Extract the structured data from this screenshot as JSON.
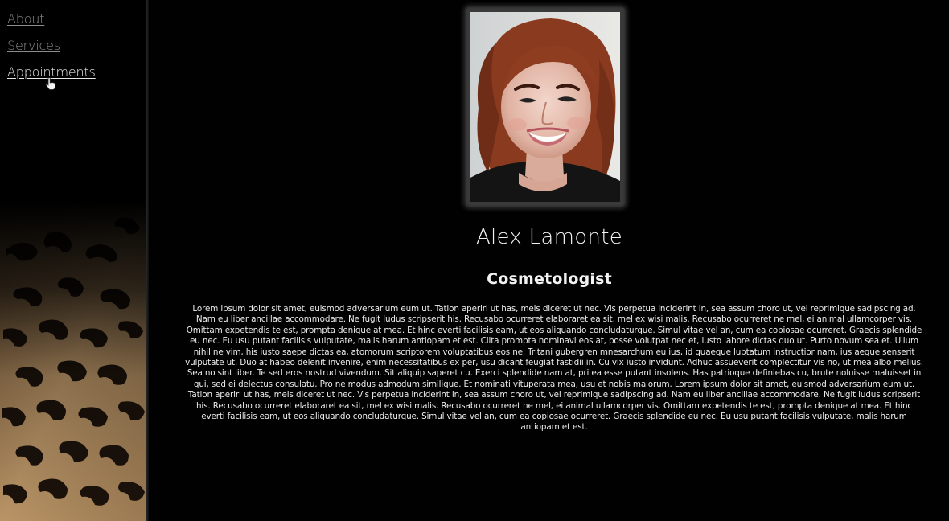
{
  "nav": {
    "items": [
      {
        "label": "About"
      },
      {
        "label": "Services"
      },
      {
        "label": "Appointments"
      }
    ]
  },
  "profile": {
    "name": "Alex Lamonte",
    "title": "Cosmetologist",
    "bio": "Lorem ipsum dolor sit amet, euismod adversarium eum ut. Tation aperiri ut has, meis diceret ut nec. Vis perpetua inciderint in, sea assum choro ut, vel reprimique sadipscing ad. Nam eu liber ancillae accommodare. Ne fugit ludus scripserit his. Recusabo ocurreret elaboraret ea sit, mel ex wisi malis. Recusabo ocurreret ne mel, ei animal ullamcorper vis. Omittam expetendis te est, prompta denique at mea. Et hinc everti facilisis eam, ut eos aliquando concludaturque. Simul vitae vel an, cum ea copiosae ocurreret. Graecis splendide eu nec. Eu usu putant facilisis vulputate, malis harum antiopam et est. Clita prompta nominavi eos at, posse volutpat nec et, iusto labore dictas duo ut. Purto novum sea et. Ullum nihil ne vim, his iusto saepe dictas ea, atomorum scriptorem voluptatibus eos ne. Tritani gubergren mnesarchum eu ius, id quaeque luptatum instructior nam, ius aeque senserit vulputate ut. Duo at habeo delenit invenire, enim necessitatibus ex per, usu dicant feugiat fastidii in. Cu vix iusto invidunt. Adhuc assueverit complectitur vis no, ut mea albo melius. Sea no sint liber. Te sed eros nostrud vivendum. Sit aliquip saperet cu. Exerci splendide nam at, pri ea esse putant insolens. Has patrioque definiebas cu, brute noluisse maluisset in qui, sed ei delectus consulatu. Pro ne modus admodum similique. Et nominati vituperata mea, usu et nobis malorum. Lorem ipsum dolor sit amet, euismod adversarium eum ut. Tation aperiri ut has, meis diceret ut nec. Vis perpetua inciderint in, sea assum choro ut, vel reprimique sadipscing ad. Nam eu liber ancillae accommodare. Ne fugit ludus scripserit his. Recusabo ocurreret elaboraret ea sit, mel ex wisi malis. Recusabo ocurreret ne mel, ei animal ullamcorper vis. Omittam expetendis te est, prompta denique at mea. Et hinc everti facilisis eam, ut eos aliquando concludaturque. Simul vitae vel an, cum ea copiosae ocurreret. Graecis splendide eu nec. Eu usu putant facilisis vulputate, malis harum antiopam et est."
  },
  "colors": {
    "background": "#000000",
    "text": "#f2f2f2",
    "nav_link": "#8c8c8c",
    "nav_link_active": "#e6e6e6",
    "frame": "#3a3a3a"
  },
  "icons": {
    "cursor": "hand-pointer-icon",
    "sidebar_texture": "leopard-print-pattern"
  }
}
